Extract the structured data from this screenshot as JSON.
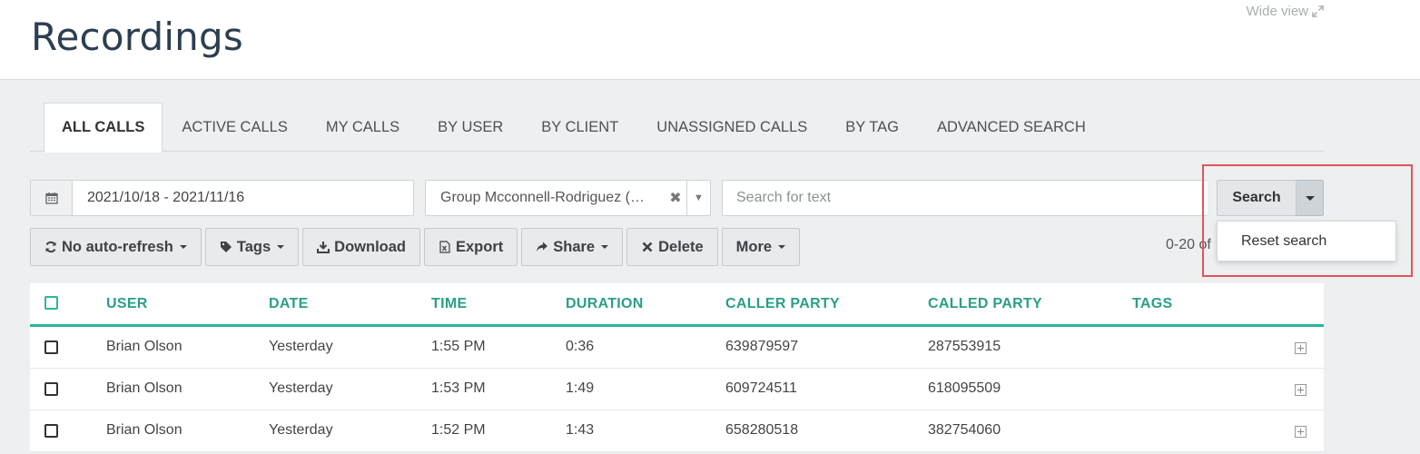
{
  "header": {
    "title": "Recordings",
    "wide_view": "Wide view"
  },
  "tabs": [
    {
      "label": "ALL CALLS",
      "active": true
    },
    {
      "label": "ACTIVE CALLS"
    },
    {
      "label": "MY CALLS"
    },
    {
      "label": "BY USER"
    },
    {
      "label": "BY CLIENT"
    },
    {
      "label": "UNASSIGNED CALLS"
    },
    {
      "label": "BY TAG"
    },
    {
      "label": "ADVANCED SEARCH"
    }
  ],
  "filters": {
    "date_range": "2021/10/18 - 2021/11/16",
    "group": "Group Mcconnell-Rodriguez (…",
    "search_placeholder": "Search for text",
    "search_button": "Search",
    "dropdown_item": "Reset search"
  },
  "toolbar": {
    "auto_refresh": "No auto-refresh",
    "tags": "Tags",
    "download": "Download",
    "export": "Export",
    "share": "Share",
    "delete": "Delete",
    "more": "More"
  },
  "pager": {
    "info": "0-20 of"
  },
  "table": {
    "columns": [
      "USER",
      "DATE",
      "TIME",
      "DURATION",
      "CALLER PARTY",
      "CALLED PARTY",
      "TAGS"
    ],
    "rows": [
      {
        "user": "Brian Olson",
        "date": "Yesterday",
        "time": "1:55 PM",
        "duration": "0:36",
        "caller": "639879597",
        "called": "287553915"
      },
      {
        "user": "Brian Olson",
        "date": "Yesterday",
        "time": "1:53 PM",
        "duration": "1:49",
        "caller": "609724511",
        "called": "618095509"
      },
      {
        "user": "Brian Olson",
        "date": "Yesterday",
        "time": "1:52 PM",
        "duration": "1:43",
        "caller": "658280518",
        "called": "382754060"
      }
    ]
  },
  "colors": {
    "accent": "#2fb59a",
    "highlight": "#e2545c",
    "title": "#2c3e50"
  }
}
